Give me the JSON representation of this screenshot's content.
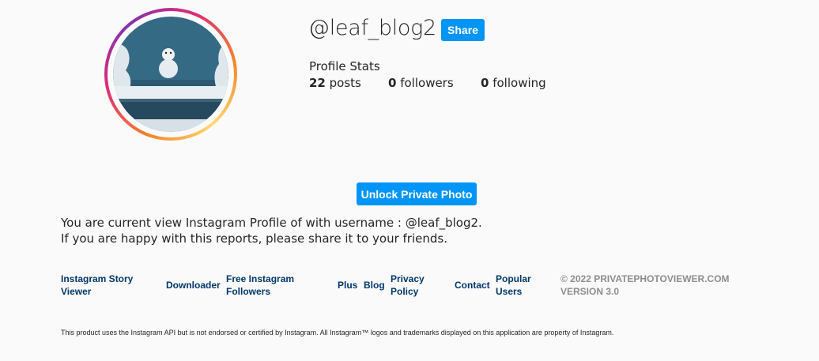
{
  "profile": {
    "username": "@leaf_blog2",
    "share_label": "Share",
    "stats_title": "Profile Stats",
    "posts_count": "22",
    "posts_label": "posts",
    "followers_count": "0",
    "followers_label": "followers",
    "following_count": "0",
    "following_label": "following"
  },
  "unlock_label": "Unlock Private Photo",
  "description": {
    "line1": "You are current view Instagram Profile of with username : @leaf_blog2.",
    "line2": "If you are happy with this reports, please share it to your friends."
  },
  "footer": {
    "links": {
      "story_viewer": "Instagram Story Viewer",
      "downloader": "Downloader",
      "free_followers": "Free Instagram Followers",
      "plus": "Plus",
      "blog": "Blog",
      "privacy": "Privacy Policy",
      "contact": "Contact",
      "popular_users": "Popular Users"
    },
    "copyright": "© 2022 PRIVATEPHOTOVIEWER.COM VERSION 3.0",
    "disclaimer": "This product uses the Instagram API but is not endorsed or certified by Instagram. All Instagram™ logos and trademarks displayed on this application are property of Instagram."
  },
  "colors": {
    "accent": "#0095f6",
    "link": "#00376b",
    "muted": "#8e8e8e"
  }
}
